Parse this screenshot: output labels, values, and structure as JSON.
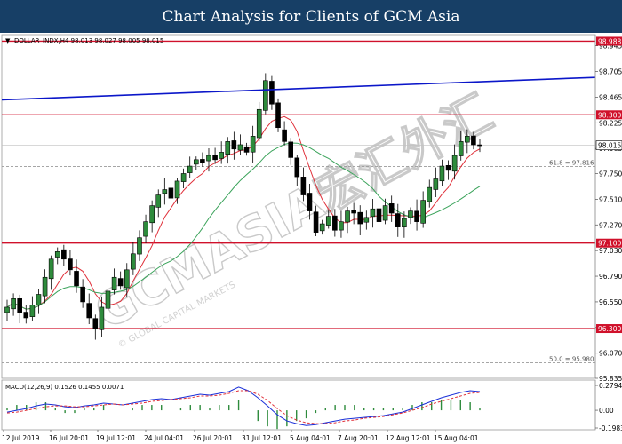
{
  "header": {
    "title": "Chart Analysis for Clients of GCM Asia"
  },
  "symbol_line": "DOLLAR_INDX,H4  98.013 98.027 98.005 98.015",
  "watermark": {
    "brand": "GCMASIA宏汇外汇",
    "tagline": "© GLOBAL CAPITAL MARKETS"
  },
  "chart_data": [
    {
      "type": "candlestick",
      "symbol": "DOLLAR_INDX",
      "timeframe": "H4",
      "ohlc_last": {
        "open": 98.013,
        "high": 98.027,
        "low": 98.005,
        "close": 98.015
      },
      "ylim": [
        95.835,
        99.05
      ],
      "y_ticks": [
        "98.945",
        "98.705",
        "98.465",
        "98.225",
        "97.985",
        "97.750",
        "97.510",
        "97.270",
        "97.030",
        "96.790",
        "96.550",
        "96.310",
        "96.070",
        "95.835"
      ],
      "x_ticks": [
        "12 Jul 2019",
        "16 Jul 20:01",
        "19 Jul 12:01",
        "24 Jul 04:01",
        "26 Jul 20:01",
        "31 Jul 12:01",
        "5 Aug 04:01",
        "7 Aug 20:01",
        "12 Aug 12:01",
        "15 Aug 04:01"
      ],
      "last_price": 98.015,
      "horizontal_levels": [
        {
          "value": 98.988,
          "label": "98.988",
          "color": "#d0112b"
        },
        {
          "value": 98.3,
          "label": "98.300",
          "color": "#d0112b"
        },
        {
          "value": 97.1,
          "label": "97.100",
          "color": "#d0112b"
        },
        {
          "value": 96.3,
          "label": "96.300",
          "color": "#d0112b"
        }
      ],
      "fibonacci": [
        {
          "label": "61.8 = 97.816",
          "value": 97.816
        },
        {
          "label": "50.0 = 95.980",
          "value": 95.98
        }
      ],
      "trendline": {
        "start": 98.44,
        "end": 98.65,
        "color": "#0b16c9"
      },
      "ma_colors": {
        "fast": "#e0303a",
        "slow": "#3aa35a"
      },
      "close_path": [
        96.5,
        96.58,
        96.45,
        96.4,
        96.52,
        96.62,
        96.78,
        96.95,
        97.02,
        96.95,
        96.85,
        96.7,
        96.55,
        96.4,
        96.3,
        96.5,
        96.65,
        96.78,
        96.7,
        96.85,
        97.0,
        97.15,
        97.3,
        97.45,
        97.55,
        97.6,
        97.52,
        97.68,
        97.75,
        97.82,
        97.88,
        97.85,
        97.92,
        97.88,
        97.95,
        98.05,
        97.98,
        98.02,
        97.95,
        98.1,
        98.35,
        98.62,
        98.4,
        98.18,
        98.05,
        97.9,
        97.72,
        97.55,
        97.4,
        97.2,
        97.28,
        97.35,
        97.22,
        97.3,
        97.4,
        97.38,
        97.28,
        97.34,
        97.42,
        97.3,
        97.45,
        97.38,
        97.25,
        97.33,
        97.4,
        97.3,
        97.5,
        97.62,
        97.7,
        97.82,
        97.78,
        97.92,
        98.05,
        98.1,
        98.02,
        98.015
      ],
      "y_label_color_axis": "#000000"
    },
    {
      "type": "line",
      "title": "MACD(12,26,9) 0.1526 0.1455 0.0071",
      "indicator": "MACD",
      "params": [
        12,
        26,
        9
      ],
      "values": {
        "macd": 0.1526,
        "signal": 0.1455,
        "histogram": 0.0071
      },
      "ylim": [
        -0.1983,
        0.2794
      ],
      "y_ticks": [
        "0.2794",
        "0.00",
        "-0.1983"
      ],
      "series": [
        {
          "name": "MACD",
          "color": "#1a2fd8",
          "values": [
            -0.02,
            0.0,
            0.02,
            0.05,
            0.07,
            0.06,
            0.04,
            0.03,
            0.05,
            0.06,
            0.08,
            0.07,
            0.06,
            0.08,
            0.1,
            0.12,
            0.13,
            0.12,
            0.14,
            0.16,
            0.18,
            0.17,
            0.19,
            0.21,
            0.26,
            0.22,
            0.14,
            0.05,
            -0.05,
            -0.12,
            -0.15,
            -0.17,
            -0.16,
            -0.14,
            -0.12,
            -0.1,
            -0.09,
            -0.08,
            -0.07,
            -0.06,
            -0.04,
            -0.02,
            0.02,
            0.06,
            0.1,
            0.14,
            0.17,
            0.2,
            0.22,
            0.21
          ]
        },
        {
          "name": "Signal",
          "color": "#e0303a",
          "values": [
            -0.03,
            -0.02,
            0.0,
            0.02,
            0.04,
            0.05,
            0.05,
            0.04,
            0.04,
            0.05,
            0.06,
            0.07,
            0.06,
            0.07,
            0.08,
            0.1,
            0.11,
            0.12,
            0.13,
            0.14,
            0.16,
            0.16,
            0.17,
            0.19,
            0.22,
            0.22,
            0.18,
            0.11,
            0.02,
            -0.06,
            -0.11,
            -0.14,
            -0.15,
            -0.15,
            -0.14,
            -0.12,
            -0.11,
            -0.09,
            -0.08,
            -0.07,
            -0.05,
            -0.03,
            0.0,
            0.03,
            0.07,
            0.1,
            0.13,
            0.16,
            0.19,
            0.2
          ]
        }
      ]
    }
  ]
}
